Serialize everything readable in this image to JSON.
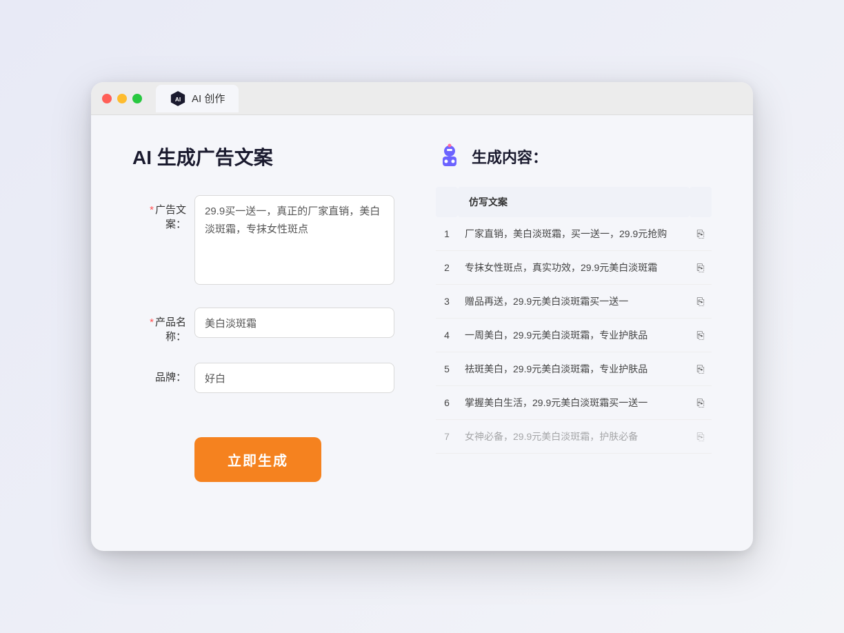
{
  "browser": {
    "tab_label": "AI 创作"
  },
  "page": {
    "title": "AI 生成广告文案"
  },
  "form": {
    "ad_copy_label": "广告文案：",
    "ad_copy_required": "*",
    "ad_copy_value": "29.9买一送一，真正的厂家直销，美白淡斑霜，专抹女性斑点",
    "product_name_label": "产品名称：",
    "product_name_required": "*",
    "product_name_value": "美白淡斑霜",
    "brand_label": "品牌：",
    "brand_value": "好白",
    "generate_btn": "立即生成"
  },
  "result": {
    "header": "生成内容：",
    "table_header": "仿写文案",
    "rows": [
      {
        "num": "1",
        "text": "厂家直销，美白淡斑霜，买一送一，29.9元抢购"
      },
      {
        "num": "2",
        "text": "专抹女性斑点，真实功效，29.9元美白淡斑霜"
      },
      {
        "num": "3",
        "text": "赠品再送，29.9元美白淡斑霜买一送一"
      },
      {
        "num": "4",
        "text": "一周美白，29.9元美白淡斑霜，专业护肤品"
      },
      {
        "num": "5",
        "text": "祛斑美白，29.9元美白淡斑霜，专业护肤品"
      },
      {
        "num": "6",
        "text": "掌握美白生活，29.9元美白淡斑霜买一送一"
      },
      {
        "num": "7",
        "text": "女神必备，29.9元美白淡斑霜，护肤必备"
      }
    ]
  }
}
